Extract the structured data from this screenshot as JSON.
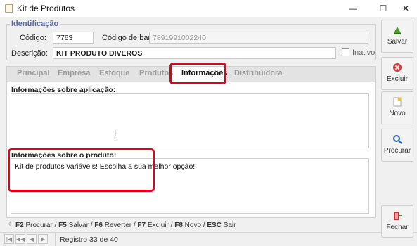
{
  "window": {
    "title": "Kit de Produtos",
    "minimize": "—",
    "maximize": "☐",
    "close": "✕"
  },
  "identificacao": {
    "title": "Identificação",
    "codigo_label": "Código:",
    "codigo_value": "7763",
    "codigo_barra_label": "Código de barra:",
    "codigo_barra_value": "7891991002240",
    "descricao_label": "Descrição:",
    "descricao_value": "KIT PRODUTO DIVEROS",
    "inativo_label": "Inativo"
  },
  "tabs": [
    {
      "label": "Principal"
    },
    {
      "label": "Empresa"
    },
    {
      "label": "Estoque"
    },
    {
      "label": "Produtos"
    },
    {
      "label": "Informações"
    },
    {
      "label": "Distribuidora"
    }
  ],
  "active_tab": "Informações",
  "informacoes": {
    "aplicacao_label": "Informações sobre aplicação:",
    "aplicacao_value": "",
    "produto_label": "Informações sobre o produto:",
    "produto_value": "Kit de produtos variáveis! Escolha a sua melhor opção!"
  },
  "shortcuts": {
    "k1": "F2",
    "t1": "Procurar /",
    "k2": "F5",
    "t2": "Salvar /",
    "k3": "F6",
    "t3": "Reverter /",
    "k4": "F7",
    "t4": "Excluir /",
    "k5": "F8",
    "t5": "Novo /",
    "k6": "ESC",
    "t6": "Sair"
  },
  "status": {
    "record": "Registro 33 de 40",
    "nav": [
      "|◀",
      "◀◀",
      "◀",
      "▶"
    ]
  },
  "toolbar": {
    "salvar": "Salvar",
    "excluir": "Excluir",
    "novo": "Novo",
    "procurar": "Procurar",
    "fechar": "Fechar"
  },
  "colors": {
    "highlight": "#e0001a",
    "group_title": "#5a6aa8"
  }
}
